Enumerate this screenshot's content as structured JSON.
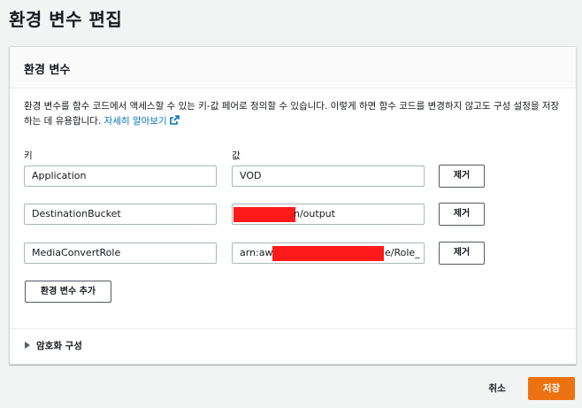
{
  "page": {
    "title": "환경 변수 편집"
  },
  "panel": {
    "title": "환경 변수",
    "description": "환경 변수를 함수 코드에서 액세스할 수 있는 키-값 페어로 정의할 수 있습니다. 이렇게 하면 함수 코드를 변경하지 않고도 구성 설정을 저장하는 데 유용합니다.",
    "learn_more_link": "자세히 알아보기",
    "key_label": "키",
    "value_label": "값",
    "variables": [
      {
        "key": "Application",
        "value": "VOD",
        "remove_label": "제거"
      },
      {
        "key": "DestinationBucket",
        "value_visible": "n/output",
        "remove_label": "제거"
      },
      {
        "key": "MediaConvertRole",
        "value_prefix": "arn:aws",
        "value_suffix": "e/Role_",
        "remove_label": "제거"
      }
    ],
    "add_button_label": "환경 변수 추가",
    "encryption_label": "암호화 구성"
  },
  "footer": {
    "cancel_label": "취소",
    "save_label": "저장"
  },
  "colors": {
    "primary_button": "#ec7211",
    "link": "#0073bb",
    "redaction": "#ff1a1a"
  }
}
